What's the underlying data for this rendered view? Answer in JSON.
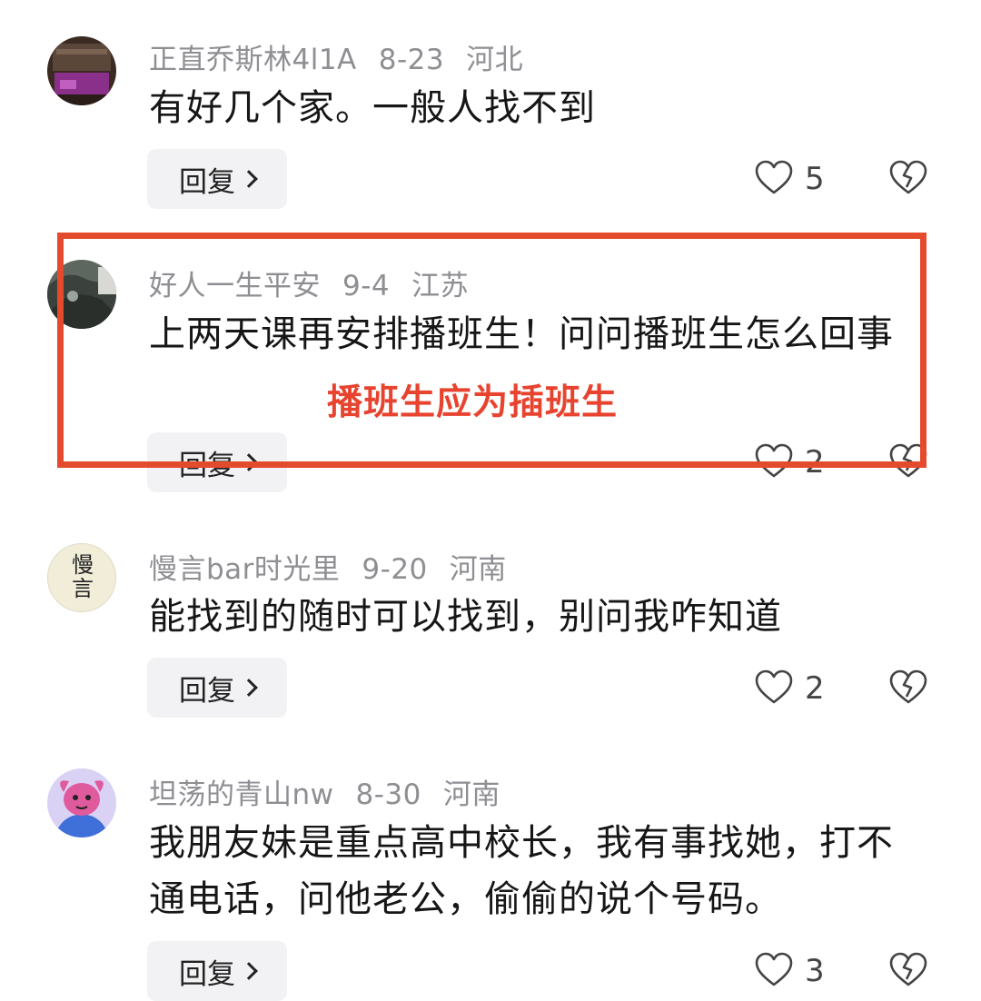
{
  "comments": [
    {
      "username": "正直乔斯林4l1A",
      "date": "8-23",
      "location": "河北",
      "text": "有好几个家。一般人找不到",
      "reply_label": "回复",
      "likes": "5"
    },
    {
      "username": "好人一生平安",
      "date": "9-4",
      "location": "江苏",
      "text": "上两天课再安排播班生！问问播班生怎么回事",
      "reply_label": "回复",
      "likes": "2"
    },
    {
      "username": "慢言bar时光里",
      "date": "9-20",
      "location": "河南",
      "text": "能找到的随时可以找到，别问我咋知道",
      "reply_label": "回复",
      "likes": "2",
      "avatar_text": "慢言"
    },
    {
      "username": "坦荡的青山nw",
      "date": "8-30",
      "location": "河南",
      "text": "我朋友妹是重点高中校长，我有事找她，打不通电话，问他老公，偷偷的说个号码。",
      "reply_label": "回复",
      "likes": "3"
    }
  ],
  "annotation": "播班生应为插班生",
  "colors": {
    "highlight": "#e44a2c",
    "annotation": "#e8432e",
    "meta": "#8e8e93"
  },
  "icons": [
    "heart-outline-icon",
    "broken-heart-icon",
    "chevron-right-icon"
  ]
}
